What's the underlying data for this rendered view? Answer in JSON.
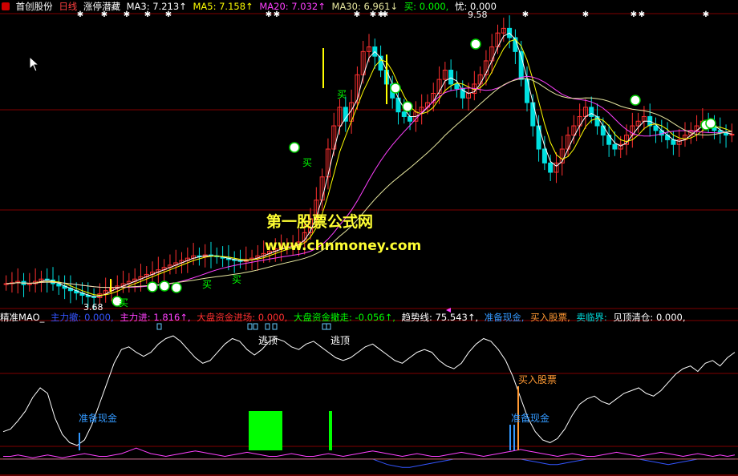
{
  "header": {
    "stock_name": "首创股份",
    "period": "日线",
    "indicator": "涨停潜藏",
    "ma3": "MA3: 7.213↑",
    "ma5": "MA5: 7.158↑",
    "ma20": "MA20: 7.032↑",
    "ma30": "MA30: 6.961↓",
    "buy": "买: 0.000,",
    "you": "忧: 0.000"
  },
  "sub_header": {
    "name": "精准MAO_",
    "zhulichu": "主力撤: 0.000,",
    "zhulijin": "主力进: 1.816↑,",
    "dapan_jin": "大盘资金进场: 0.000,",
    "dapan_che": "大盘资金撤走: -0.056↑,",
    "qushi": "趋势线: 75.543↑,",
    "zhunbei": "准备现金,",
    "mairu": "买入股票,",
    "mailin": "卖临界:",
    "jianding": "见顶清仓: 0.000,"
  },
  "watermark": {
    "title": "第一股票公式网",
    "url": "www.chnmoney.com"
  },
  "colors": {
    "up": "#ff3030",
    "down": "#00e0e0",
    "ma3": "#ffffff",
    "ma5": "#ffff00",
    "ma20": "#ff40ff",
    "ma30": "#e8e8a0",
    "grid": "#800000",
    "green_bar": "#00ff00",
    "blue_marker": "#3399ff",
    "orange_marker": "#ff9933"
  },
  "chart_data": [
    {
      "type": "candlestick",
      "title": "首创股份 日线",
      "price_high_label": "9.58",
      "price_low_label": "3.68",
      "ylim": [
        3.5,
        9.8
      ],
      "close": [
        4.0,
        4.02,
        4.05,
        3.98,
        4.0,
        4.05,
        4.1,
        4.08,
        4.0,
        3.95,
        3.9,
        3.85,
        3.8,
        3.75,
        3.72,
        3.7,
        3.78,
        3.85,
        3.9,
        3.95,
        4.0,
        4.05,
        4.1,
        4.15,
        4.2,
        4.25,
        4.3,
        4.35,
        4.4,
        4.45,
        4.5,
        4.55,
        4.6,
        4.58,
        4.62,
        4.6,
        4.58,
        4.55,
        4.52,
        4.5,
        4.48,
        4.52,
        4.55,
        4.6,
        4.65,
        4.7,
        4.75,
        4.78,
        4.8,
        4.82,
        4.9,
        5.1,
        5.4,
        5.8,
        6.3,
        6.9,
        7.4,
        7.8,
        7.5,
        7.9,
        8.5,
        9.0,
        9.1,
        8.9,
        8.6,
        8.3,
        8.0,
        7.7,
        7.6,
        7.5,
        7.7,
        7.8,
        7.9,
        8.1,
        8.4,
        8.6,
        8.3,
        8.2,
        8.0,
        8.1,
        8.3,
        8.5,
        8.8,
        9.1,
        9.4,
        9.5,
        9.3,
        9.0,
        8.4,
        7.9,
        7.4,
        6.9,
        6.6,
        6.4,
        6.6,
        6.9,
        7.2,
        7.4,
        7.6,
        7.8,
        7.6,
        7.4,
        7.2,
        7.0,
        6.9,
        7.0,
        7.2,
        7.4,
        7.5,
        7.6,
        7.4,
        7.3,
        7.2,
        7.1,
        7.0,
        7.1,
        7.2,
        7.3,
        7.4,
        7.5,
        7.4,
        7.3,
        7.25,
        7.2,
        7.22
      ]
    },
    {
      "type": "line",
      "series": [
        {
          "name": "趋势线",
          "values": [
            20,
            22,
            28,
            35,
            45,
            52,
            48,
            30,
            18,
            12,
            10,
            14,
            25,
            40,
            55,
            70,
            80,
            82,
            78,
            75,
            78,
            84,
            88,
            90,
            86,
            80,
            74,
            70,
            72,
            78,
            84,
            88,
            86,
            80,
            76,
            80,
            86,
            88,
            86,
            82,
            80,
            84,
            86,
            82,
            78,
            74,
            72,
            74,
            78,
            82,
            84,
            80,
            76,
            72,
            70,
            74,
            78,
            80,
            78,
            72,
            68,
            66,
            70,
            78,
            84,
            88,
            86,
            80,
            72,
            60,
            45,
            30,
            20,
            14,
            12,
            15,
            22,
            32,
            40,
            44,
            46,
            42,
            40,
            44,
            48,
            50,
            52,
            48,
            46,
            50,
            56,
            62,
            66,
            68,
            64,
            70,
            72,
            68,
            74,
            78
          ]
        },
        {
          "name": "主力进",
          "values": [
            2,
            2,
            3,
            2,
            1,
            2,
            3,
            2,
            1,
            2,
            3,
            4,
            3,
            2,
            2,
            3,
            4,
            6,
            8,
            6,
            4,
            3,
            2,
            3,
            4,
            5,
            6,
            5,
            4,
            3,
            2,
            3,
            4,
            5,
            4,
            3,
            2,
            2,
            3,
            4,
            3,
            2,
            2,
            3,
            4,
            3,
            2,
            3,
            4,
            5,
            6,
            5,
            4,
            3,
            2,
            3,
            4,
            3,
            2,
            2,
            3,
            4,
            5,
            4,
            3,
            2,
            3,
            4,
            5,
            6,
            7,
            6,
            5,
            4,
            3,
            2,
            3,
            4,
            3,
            2,
            2,
            3,
            4,
            5,
            4,
            3,
            2,
            3,
            4,
            5,
            4,
            3,
            2,
            3,
            4,
            3,
            2,
            3,
            2,
            3
          ]
        },
        {
          "name": "大盘资金撤走",
          "values": [
            0,
            0,
            0,
            0,
            0,
            0,
            0,
            0,
            0,
            0,
            0,
            0,
            0,
            0,
            0,
            0,
            0,
            0,
            0,
            0,
            0,
            0,
            0,
            0,
            0,
            0,
            0,
            0,
            0,
            0,
            0,
            0,
            0,
            0,
            0,
            0,
            0,
            0,
            0,
            0,
            0,
            0,
            0,
            0,
            0,
            0,
            0,
            0,
            0,
            0,
            0,
            -2,
            -4,
            -5,
            -6,
            -6,
            -5,
            -4,
            -3,
            -2,
            -1,
            0,
            0,
            0,
            0,
            0,
            0,
            0,
            0,
            0,
            0,
            -1,
            -2,
            -3,
            -4,
            -4,
            -3,
            -2,
            -1,
            0,
            0,
            0,
            0,
            0,
            0,
            0,
            0,
            -1,
            -2,
            -3,
            -4,
            -3,
            -2,
            -1,
            0,
            0,
            0,
            0,
            0,
            0
          ]
        }
      ],
      "ylim": [
        -10,
        100
      ],
      "annotations": [
        "逃顶",
        "逃顶",
        "准备现金",
        "准备现金",
        "买入股票"
      ]
    }
  ],
  "annotations": {
    "buy": "买",
    "escape": "逃顶",
    "cash": "准备现金",
    "buy_stock": "买入股票"
  }
}
